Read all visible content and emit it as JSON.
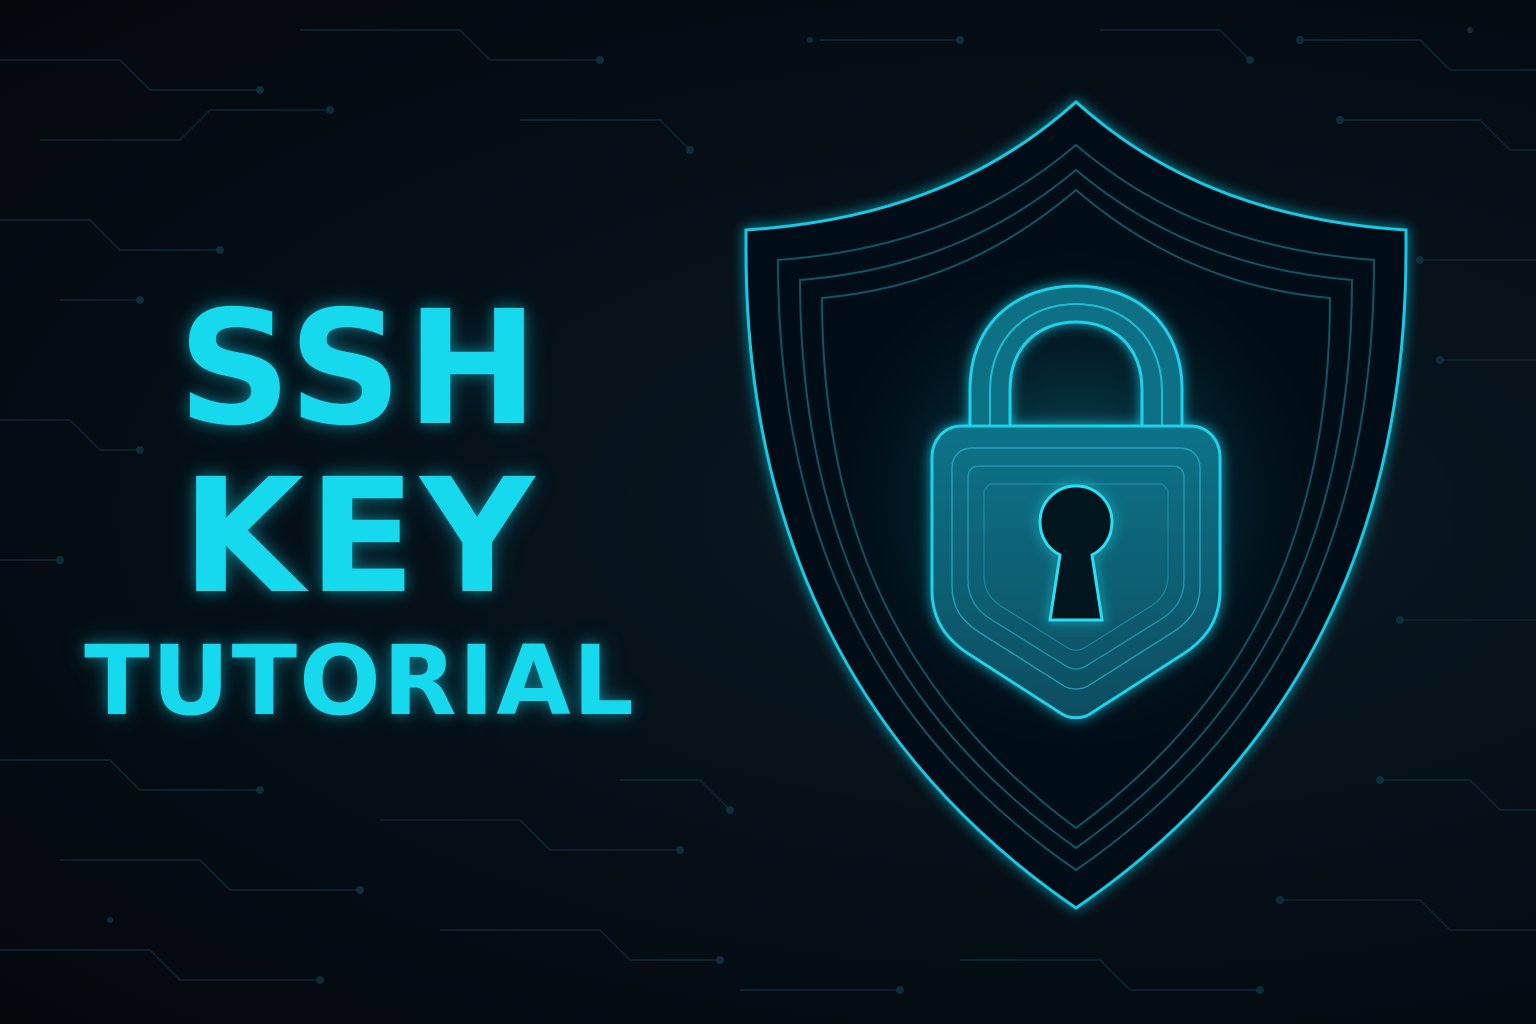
{
  "title": {
    "line1": "SSH",
    "line2": "KEY",
    "line3": "TUTORIAL"
  },
  "icons": {
    "shield": "shield-icon",
    "lock": "padlock-icon",
    "keyhole": "keyhole-icon",
    "background": "circuit-pattern"
  },
  "colors": {
    "background": "#050c12",
    "accent": "#16d9ee",
    "glow": "#1fb8d6"
  }
}
